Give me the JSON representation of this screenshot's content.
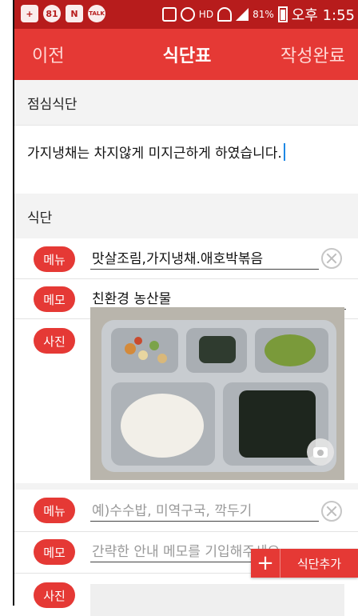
{
  "status_bar": {
    "battery": "81%",
    "time": "오후 1:55",
    "icons": [
      "plus-icon",
      "notification-81-icon",
      "naver-icon",
      "talk-icon",
      "vibrate-icon",
      "alarm-icon",
      "hd-voice-icon",
      "wifi-icon",
      "signal-icon",
      "battery-icon"
    ],
    "badge_count": "81",
    "naver_label": "N",
    "talk_label": "TALK",
    "hd_label": "HD"
  },
  "header": {
    "prev_label": "이전",
    "title": "식단표",
    "done_label": "작성완료"
  },
  "lunch_section": {
    "title": "점심식단",
    "memo": "가지냉채는 차지않게 미지근하게 하였습니다."
  },
  "menu_section": {
    "title": "식단",
    "entries": [
      {
        "menu_label": "메뉴",
        "menu_value": "맛살조림,가지냉채.애호박볶음",
        "memo_label": "메모",
        "memo_value": "친환경 농산물",
        "photo_label": "사진"
      },
      {
        "menu_label": "메뉴",
        "menu_placeholder": "예)수수밥, 미역구국, 깍두기",
        "memo_label": "메모",
        "memo_placeholder": "간략한 안내 메모를 기입해주세요",
        "photo_label": "사진"
      }
    ]
  },
  "add_button": {
    "label": "식단추가",
    "icon": "plus-icon"
  },
  "colors": {
    "status_bar": "#b71c1c",
    "header": "#e53935",
    "accent": "#e53935"
  }
}
